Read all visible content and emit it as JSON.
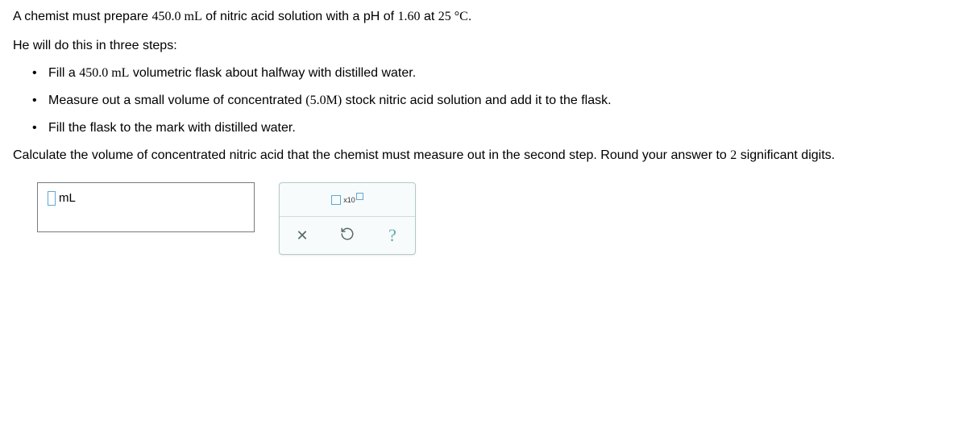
{
  "intro_p1_a": "A chemist must prepare ",
  "intro_p1_vol": "450.0 mL",
  "intro_p1_b": " of nitric acid solution with a pH of ",
  "intro_p1_ph": "1.60",
  "intro_p1_c": " at ",
  "intro_p1_temp": "25 °C",
  "intro_p1_d": ".",
  "steps_intro": "He will do this in three steps:",
  "step1_a": "Fill a ",
  "step1_vol": "450.0 mL",
  "step1_b": " volumetric flask about halfway with distilled water.",
  "step2_a": "Measure out a small volume of concentrated ",
  "step2_conc": "(5.0M)",
  "step2_b": " stock nitric acid solution and add it to the flask.",
  "step3": "Fill the flask to the mark with distilled water.",
  "calc_a": "Calculate the volume of concentrated nitric acid that the chemist must measure out in the second step. Round your answer to ",
  "calc_sig": "2",
  "calc_b": " significant digits.",
  "answer_unit": "mL",
  "sci_x10": "x10"
}
